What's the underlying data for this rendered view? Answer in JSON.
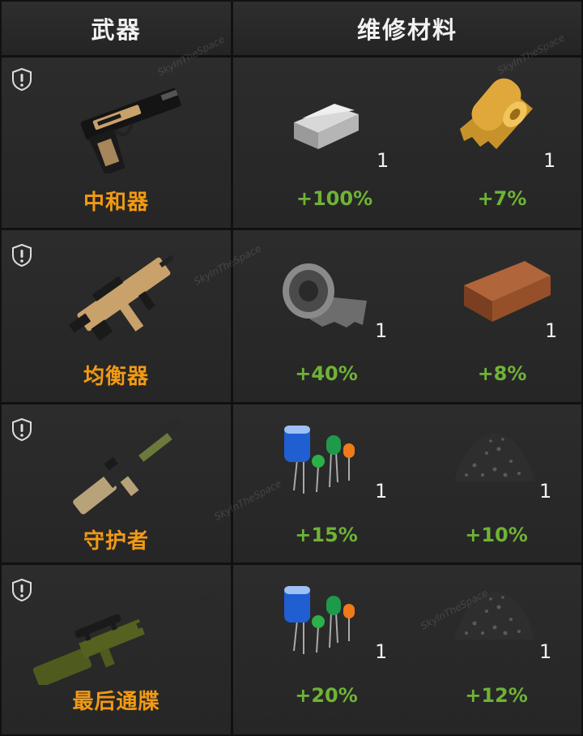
{
  "header": {
    "weapon_col": "武器",
    "materials_col": "维修材料"
  },
  "watermark": "SkyInTheSpace",
  "rows": [
    {
      "weapon": {
        "name": "中和器",
        "icon": "pistol-icon"
      },
      "materials": [
        {
          "icon": "iron-ingot-icon",
          "qty": "1",
          "bonus": "+100%"
        },
        {
          "icon": "gold-foil-roll-icon",
          "qty": "1",
          "bonus": "+7%"
        }
      ]
    },
    {
      "weapon": {
        "name": "均衡器",
        "icon": "smg-icon"
      },
      "materials": [
        {
          "icon": "metal-sheet-roll-icon",
          "qty": "1",
          "bonus": "+40%"
        },
        {
          "icon": "copper-ingot-icon",
          "qty": "1",
          "bonus": "+8%"
        }
      ]
    },
    {
      "weapon": {
        "name": "守护者",
        "icon": "shotgun-icon"
      },
      "materials": [
        {
          "icon": "electronic-components-icon",
          "qty": "1",
          "bonus": "+15%"
        },
        {
          "icon": "black-gravel-pile-icon",
          "qty": "1",
          "bonus": "+10%"
        }
      ]
    },
    {
      "weapon": {
        "name": "最后通牒",
        "icon": "sniper-rifle-icon"
      },
      "materials": [
        {
          "icon": "electronic-components-icon",
          "qty": "1",
          "bonus": "+20%"
        },
        {
          "icon": "black-gravel-pile-icon",
          "qty": "1",
          "bonus": "+12%"
        }
      ]
    }
  ],
  "colors": {
    "weapon_name": "#f29a13",
    "bonus": "#6fb336",
    "background": "#262626"
  }
}
